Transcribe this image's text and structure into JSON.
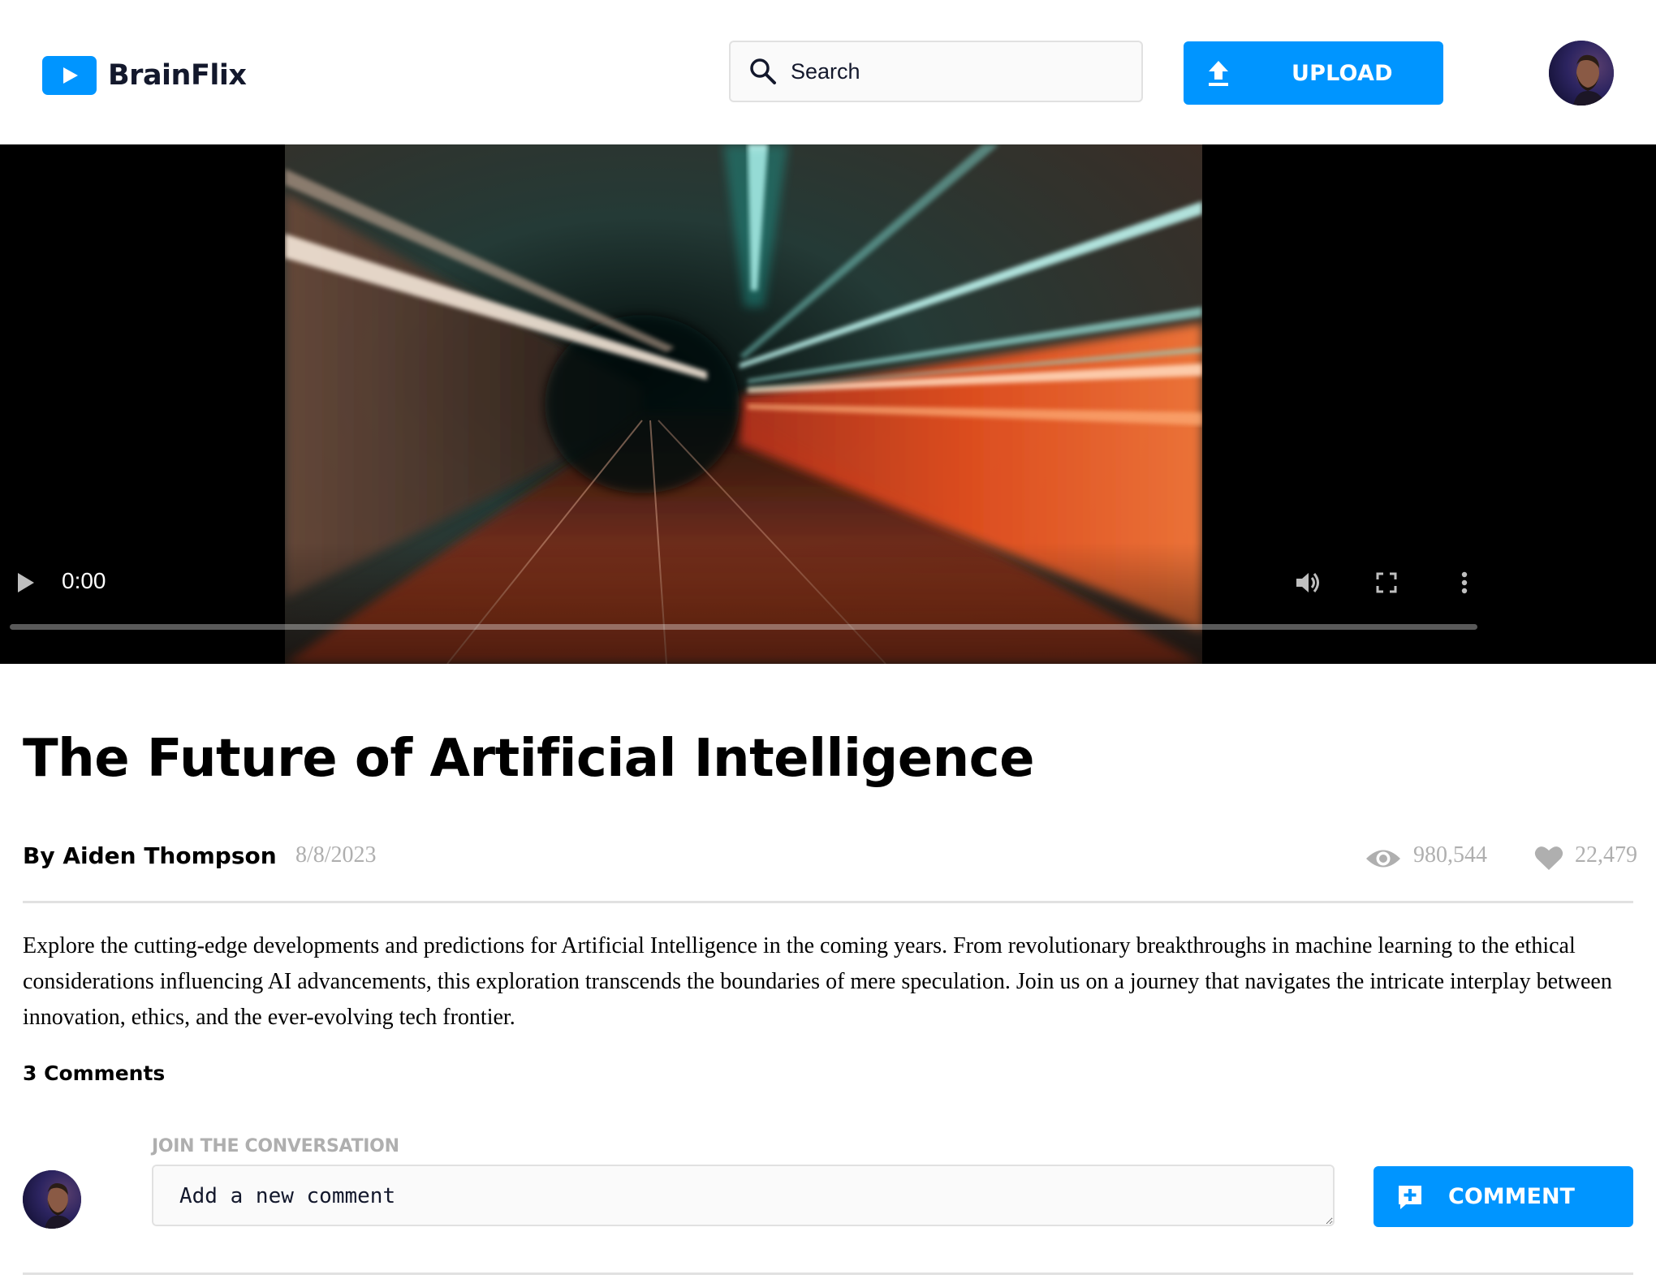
{
  "colors": {
    "brand": "#0095FF",
    "text_dark": "#13182C",
    "muted": "#AFAFAF",
    "border": "#E1E1E1"
  },
  "header": {
    "logo_text": "BrainFlix",
    "logo_icon": "play-icon",
    "search": {
      "placeholder": "Search",
      "icon": "search-icon"
    },
    "upload_button": {
      "label": "UPLOAD",
      "icon": "upload-icon"
    },
    "avatar_icon": "user-avatar"
  },
  "video": {
    "current_time": "0:00",
    "progress": 0,
    "controls": [
      "play-icon",
      "volume-icon",
      "fullscreen-icon",
      "more-options-icon"
    ]
  },
  "main": {
    "title": "The Future of Artificial Intelligence",
    "author": "By Aiden Thompson",
    "date": "8/8/2023",
    "views": "980,544",
    "views_icon": "eye-icon",
    "likes": "22,479",
    "likes_icon": "heart-icon",
    "description": "Explore the cutting-edge developments and predictions for Artificial Intelligence in the coming years. From revolutionary breakthroughs in machine learning to the ethical considerations influencing AI advancements, this exploration transcends the boundaries of mere speculation. Join us on a journey that navigates the intricate interplay between innovation, ethics, and the ever-evolving tech frontier."
  },
  "comments": {
    "count_label": "3 Comments",
    "form_label": "JOIN THE CONVERSATION",
    "input_placeholder": "Add a new comment",
    "input_value": "",
    "button_label": "COMMENT",
    "button_icon": "add-comment-icon"
  }
}
